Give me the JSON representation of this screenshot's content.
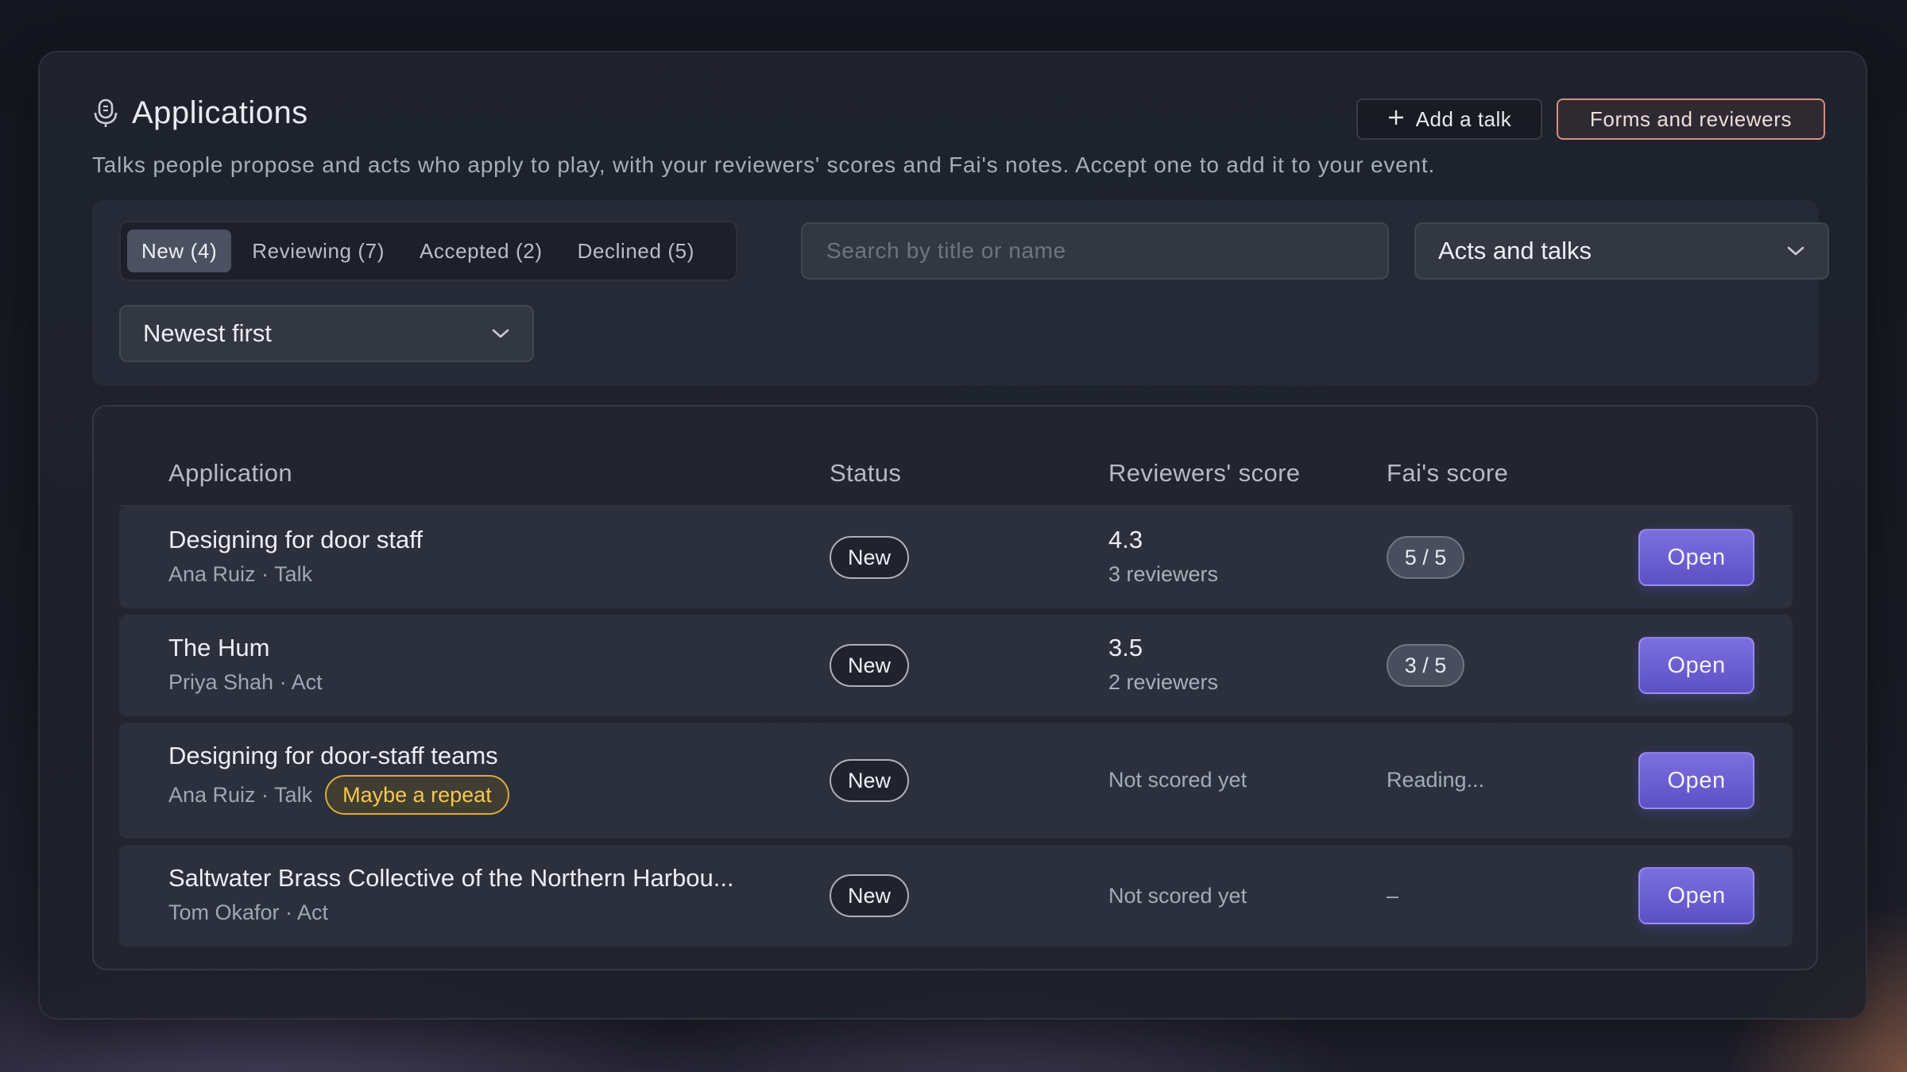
{
  "header": {
    "title": "Applications",
    "subtitle": "Talks people propose and acts who apply to play, with your reviewers' scores and Fai's notes. Accept one to add it to your event.",
    "add_talk_label": "Add a talk",
    "forms_label": "Forms and reviewers"
  },
  "filters": {
    "tabs": [
      {
        "label": "New (4)",
        "active": true
      },
      {
        "label": "Reviewing (7)",
        "active": false
      },
      {
        "label": "Accepted (2)",
        "active": false
      },
      {
        "label": "Declined (5)",
        "active": false
      }
    ],
    "search_placeholder": "Search by title or name",
    "search_value": "",
    "kind_select": "Acts and talks",
    "sort_select": "Newest first"
  },
  "table": {
    "columns": {
      "application": "Application",
      "status": "Status",
      "reviewers_score": "Reviewers' score",
      "fai_score": "Fai's score"
    },
    "rows": [
      {
        "title": "Designing for door staff",
        "subtitle": "Ana Ruiz · Talk",
        "badge": "",
        "status": "New",
        "score": "4.3",
        "reviewers": "3 reviewers",
        "score_text": "",
        "fai": "5 / 5",
        "fai_text": "",
        "action": "Open"
      },
      {
        "title": "The Hum",
        "subtitle": "Priya Shah · Act",
        "badge": "",
        "status": "New",
        "score": "3.5",
        "reviewers": "2 reviewers",
        "score_text": "",
        "fai": "3 / 5",
        "fai_text": "",
        "action": "Open"
      },
      {
        "title": "Designing for door-staff teams",
        "subtitle": "Ana Ruiz · Talk",
        "badge": "Maybe a repeat",
        "status": "New",
        "score": "",
        "reviewers": "",
        "score_text": "Not scored yet",
        "fai": "",
        "fai_text": "Reading...",
        "action": "Open"
      },
      {
        "title": "Saltwater Brass Collective of the Northern Harbou...",
        "subtitle": "Tom Okafor · Act",
        "badge": "",
        "status": "New",
        "score": "",
        "reviewers": "",
        "score_text": "Not scored yet",
        "fai": "",
        "fai_text": "–",
        "action": "Open"
      }
    ]
  },
  "icons": {
    "header": "microphone-icon",
    "add": "plus-icon",
    "dropdown": "chevron-down-icon"
  },
  "colors": {
    "accent": "#6c61d8",
    "warning": "#f2c94c",
    "forms_border": "#d78f7f"
  }
}
